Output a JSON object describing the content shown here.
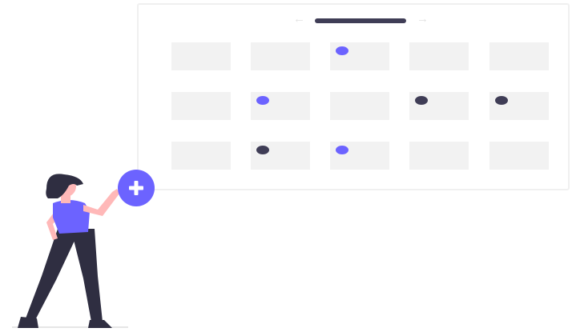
{
  "colors": {
    "accent": "#6c63ff",
    "dark": "#3f3d56",
    "cell": "#f2f2f2",
    "skin": "#ffb8b8",
    "hair": "#2f2e41"
  },
  "calendar": {
    "prev_icon": "arrow-left-icon",
    "next_icon": "arrow-right-icon",
    "cells": [
      {
        "row": 0,
        "col": 0,
        "dot": null
      },
      {
        "row": 0,
        "col": 1,
        "dot": null
      },
      {
        "row": 0,
        "col": 2,
        "dot": "accent"
      },
      {
        "row": 0,
        "col": 3,
        "dot": null
      },
      {
        "row": 0,
        "col": 4,
        "dot": null
      },
      {
        "row": 1,
        "col": 0,
        "dot": null
      },
      {
        "row": 1,
        "col": 1,
        "dot": "accent"
      },
      {
        "row": 1,
        "col": 2,
        "dot": null
      },
      {
        "row": 1,
        "col": 3,
        "dot": "dark"
      },
      {
        "row": 1,
        "col": 4,
        "dot": "dark"
      },
      {
        "row": 2,
        "col": 0,
        "dot": null
      },
      {
        "row": 2,
        "col": 1,
        "dot": "dark"
      },
      {
        "row": 2,
        "col": 2,
        "dot": "accent"
      },
      {
        "row": 2,
        "col": 3,
        "dot": null
      },
      {
        "row": 2,
        "col": 4,
        "dot": null
      }
    ]
  },
  "add_button": {
    "icon": "plus-icon"
  }
}
